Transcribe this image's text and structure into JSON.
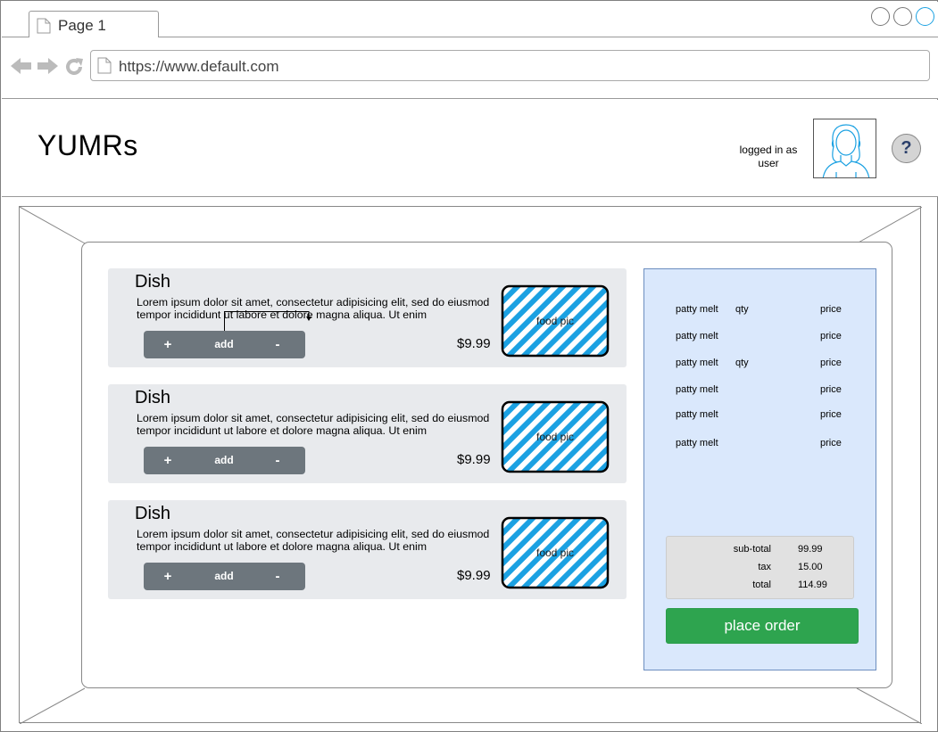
{
  "browser": {
    "tab_label": "Page 1",
    "url": "https://www.default.com"
  },
  "header": {
    "brand": "YUMRs",
    "login_status": "logged in as user",
    "help_label": "?"
  },
  "dishes": [
    {
      "title": "Dish",
      "description": "Lorem ipsum dolor sit amet, consectetur adipisicing elit, sed do eiusmod tempor incididunt ut labore et dolore magna aliqua. Ut enim",
      "price": "$9.99",
      "pic_label": "food pic",
      "plus": "+",
      "add": "add",
      "minus": "-"
    },
    {
      "title": "Dish",
      "description": "Lorem ipsum dolor sit amet, consectetur adipisicing elit, sed do eiusmod tempor incididunt ut labore et dolore magna aliqua. Ut enim",
      "price": "$9.99",
      "pic_label": "food pic",
      "plus": "+",
      "add": "add",
      "minus": "-"
    },
    {
      "title": "Dish",
      "description": "Lorem ipsum dolor sit amet, consectetur adipisicing elit, sed do eiusmod tempor incididunt ut labore et dolore magna aliqua. Ut enim",
      "price": "$9.99",
      "pic_label": "food pic",
      "plus": "+",
      "add": "add",
      "minus": "-"
    }
  ],
  "order": {
    "items": [
      {
        "name": "patty melt",
        "qty": "qty",
        "price": "price"
      },
      {
        "name": "patty melt",
        "qty": "",
        "price": "price"
      },
      {
        "name": "patty melt",
        "qty": "qty",
        "price": "price"
      },
      {
        "name": "patty melt",
        "qty": "",
        "price": "price"
      },
      {
        "name": "patty melt",
        "qty": "",
        "price": "price"
      },
      {
        "name": "patty melt",
        "qty": "",
        "price": "price"
      }
    ],
    "subtotal_label": "sub-total",
    "subtotal": "99.99",
    "tax_label": "tax",
    "tax": "15.00",
    "total_label": "total",
    "total": "114.99",
    "place_order_label": "place order"
  },
  "colors": {
    "accent_green": "#2ea44f",
    "order_panel_bg": "#dae8fc",
    "hatch_blue": "#1ba1e2",
    "control_gray": "#6d767d"
  }
}
